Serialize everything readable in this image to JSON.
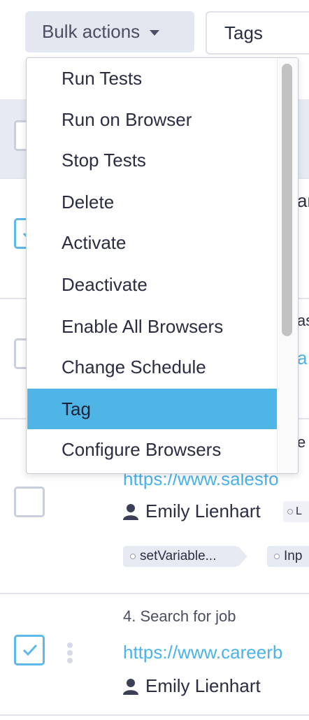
{
  "toolbar": {
    "bulk_actions_label": "Bulk actions",
    "tags_placeholder": "Tags"
  },
  "menu": {
    "items": [
      "Run Tests",
      "Run on Browser",
      "Stop Tests",
      "Delete",
      "Activate",
      "Deactivate",
      "Enable All Browsers",
      "Change Schedule",
      "Tag",
      "Configure Browsers"
    ],
    "active_item": "Tag"
  },
  "rows_peek": {
    "row1_fragment": "an",
    "row2_fragment_text": "as",
    "row2_fragment_link": "a."
  },
  "rows": [
    {
      "title_fragment": "e",
      "link": "https://www.salesfo",
      "user": "Emily Lienhart",
      "user_chip": "L",
      "tags": [
        "setVariable...",
        "Inp"
      ]
    },
    {
      "title": "4. Search for job",
      "link": "https://www.careerb",
      "user": "Emily Lienhart",
      "checked": true
    }
  ],
  "colors": {
    "accent": "#4fb5e7",
    "link": "#4ab3e8",
    "header_band": "#e8eaf3"
  }
}
